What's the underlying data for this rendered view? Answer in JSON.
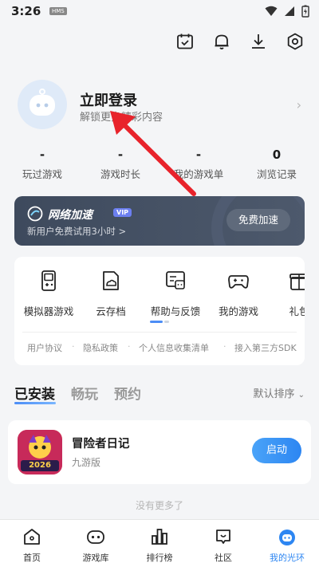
{
  "status_bar": {
    "time": "3:26",
    "carrier": "HMS"
  },
  "profile": {
    "login_title": "立即登录",
    "login_subtitle": "解锁更多精彩内容"
  },
  "stats": [
    {
      "value": "-",
      "label": "玩过游戏"
    },
    {
      "value": "-",
      "label": "游戏时长"
    },
    {
      "value": "-",
      "label": "我的游戏单"
    },
    {
      "value": "0",
      "label": "浏览记录"
    }
  ],
  "vip_banner": {
    "title": "网络加速",
    "badge": "VIP",
    "subtitle": "新用户免费试用3小时 >",
    "button": "免费加速"
  },
  "tools": [
    {
      "label": "模拟器游戏",
      "icon": "gameboy-icon"
    },
    {
      "label": "云存档",
      "icon": "cloud-save-icon"
    },
    {
      "label": "帮助与反馈",
      "icon": "help-feedback-icon"
    },
    {
      "label": "我的游戏",
      "icon": "gamepad-icon"
    },
    {
      "label": "礼包",
      "icon": "gift-icon"
    }
  ],
  "links": {
    "user_agreement": "用户协议",
    "privacy_policy": "隐私政策",
    "personal_info": "个人信息收集清单",
    "third_party_sdk": "接入第三方SDK"
  },
  "tabs": [
    {
      "label": "已安装",
      "active": true
    },
    {
      "label": "畅玩",
      "active": false
    },
    {
      "label": "预约",
      "active": false
    }
  ],
  "sort_label": "默认排序",
  "game": {
    "name": "冒险者日记",
    "subtitle": "九游版",
    "button": "启动",
    "icon_year": "2026"
  },
  "no_more": "没有更多了",
  "bottom_nav": [
    {
      "label": "首页",
      "icon": "home-icon",
      "active": false
    },
    {
      "label": "游戏库",
      "icon": "game-library-icon",
      "active": false
    },
    {
      "label": "排行榜",
      "icon": "ranking-icon",
      "active": false
    },
    {
      "label": "社区",
      "icon": "community-icon",
      "active": false
    },
    {
      "label": "我的光环",
      "icon": "profile-halo-icon",
      "active": true
    }
  ],
  "colors": {
    "accent": "#2d86f2",
    "vip_bg": "#3e4a5d",
    "arrow": "#e8232b"
  }
}
